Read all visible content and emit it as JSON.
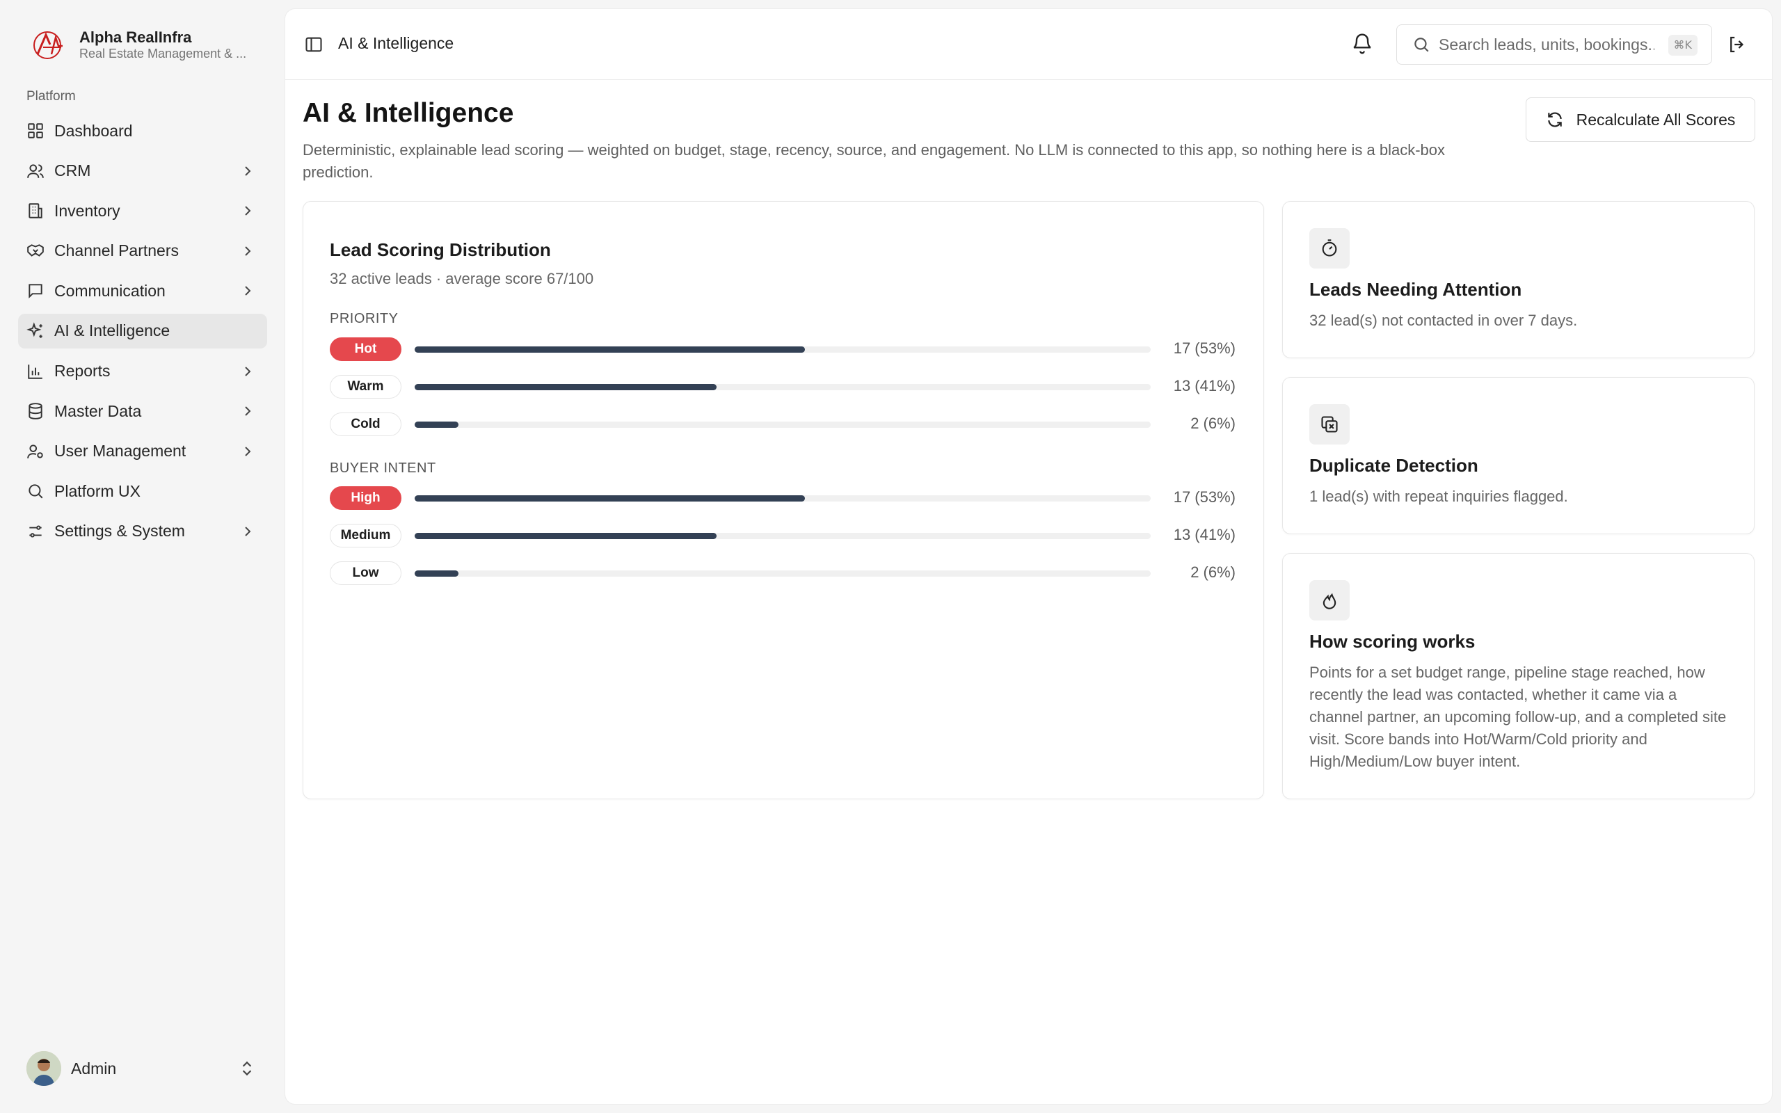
{
  "brand": {
    "name": "Alpha RealInfra",
    "subtitle": "Real Estate Management & ..."
  },
  "sidebar": {
    "group_label": "Platform",
    "items": [
      {
        "label": "Dashboard",
        "icon": "grid-icon",
        "chevron": false,
        "active": false
      },
      {
        "label": "CRM",
        "icon": "users-icon",
        "chevron": true,
        "active": false
      },
      {
        "label": "Inventory",
        "icon": "building-icon",
        "chevron": true,
        "active": false
      },
      {
        "label": "Channel Partners",
        "icon": "handshake-icon",
        "chevron": true,
        "active": false
      },
      {
        "label": "Communication",
        "icon": "message-icon",
        "chevron": true,
        "active": false
      },
      {
        "label": "AI & Intelligence",
        "icon": "sparkles-icon",
        "chevron": false,
        "active": true
      },
      {
        "label": "Reports",
        "icon": "bar-chart-icon",
        "chevron": true,
        "active": false
      },
      {
        "label": "Master Data",
        "icon": "database-icon",
        "chevron": true,
        "active": false
      },
      {
        "label": "User Management",
        "icon": "user-cog-icon",
        "chevron": true,
        "active": false
      },
      {
        "label": "Platform UX",
        "icon": "search-icon",
        "chevron": false,
        "active": false
      },
      {
        "label": "Settings & System",
        "icon": "sliders-icon",
        "chevron": true,
        "active": false
      }
    ],
    "user": {
      "name": "Admin"
    }
  },
  "header": {
    "breadcrumb": "AI & Intelligence",
    "search_placeholder": "Search leads, units, bookings...",
    "search_shortcut": "⌘K"
  },
  "page": {
    "title": "AI & Intelligence",
    "description": "Deterministic, explainable lead scoring — weighted on budget, stage, recency, source, and engagement. No LLM is connected to this app, so nothing here is a black-box prediction.",
    "recalc_label": "Recalculate All Scores"
  },
  "distribution": {
    "title": "Lead Scoring Distribution",
    "subtitle": "32 active leads · average score 67/100",
    "priority_label": "PRIORITY",
    "priority": [
      {
        "label": "Hot",
        "count_text": "17 (53%)",
        "fraction": 0.53,
        "highlight": true
      },
      {
        "label": "Warm",
        "count_text": "13 (41%)",
        "fraction": 0.41,
        "highlight": false
      },
      {
        "label": "Cold",
        "count_text": "2 (6%)",
        "fraction": 0.06,
        "highlight": false
      }
    ],
    "intent_label": "BUYER INTENT",
    "intent": [
      {
        "label": "High",
        "count_text": "17 (53%)",
        "fraction": 0.53,
        "highlight": true
      },
      {
        "label": "Medium",
        "count_text": "13 (41%)",
        "fraction": 0.41,
        "highlight": false
      },
      {
        "label": "Low",
        "count_text": "2 (6%)",
        "fraction": 0.06,
        "highlight": false
      }
    ]
  },
  "cards": {
    "attention": {
      "icon": "timer-icon",
      "title": "Leads Needing Attention",
      "text": "32 lead(s) not contacted in over 7 days."
    },
    "duplicate": {
      "icon": "copy-x-icon",
      "title": "Duplicate Detection",
      "text": "1 lead(s) with repeat inquiries flagged."
    },
    "how": {
      "icon": "flame-icon",
      "title": "How scoring works",
      "text": "Points for a set budget range, pipeline stage reached, how recently the lead was contacted, whether it came via a channel partner, an upcoming follow-up, and a completed site visit. Score bands into Hot/Warm/Cold priority and High/Medium/Low buyer intent."
    }
  },
  "colors": {
    "accent_red": "#e5484d",
    "bar_fill": "#334155",
    "track": "#f0f0f0"
  }
}
